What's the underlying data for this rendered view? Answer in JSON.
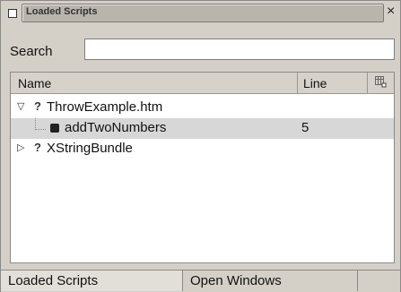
{
  "window": {
    "title": "Loaded Scripts",
    "close_glyph": "×"
  },
  "search": {
    "label": "Search",
    "value": "",
    "placeholder": ""
  },
  "columns": {
    "name": "Name",
    "line": "Line"
  },
  "tree": {
    "rows": [
      {
        "name": "ThrowExample.htm",
        "line": "",
        "expanded": true,
        "badge": "?"
      },
      {
        "name": "addTwoNumbers",
        "line": "5",
        "selected": true
      },
      {
        "name": "XStringBundle",
        "line": "",
        "expanded": false,
        "badge": "?"
      }
    ]
  },
  "tabs": [
    {
      "label": "Loaded Scripts",
      "active": true
    },
    {
      "label": "Open Windows",
      "active": false
    }
  ],
  "icons": {
    "title_box": "square-outline-icon",
    "close": "close-icon",
    "column_picker": "column-picker-icon",
    "expanded_twisty": "triangle-down-icon",
    "collapsed_twisty": "triangle-right-icon",
    "function": "function-icon"
  },
  "colors": {
    "selected_row": "#d7d7d7",
    "chrome": "#d4d0c8"
  }
}
